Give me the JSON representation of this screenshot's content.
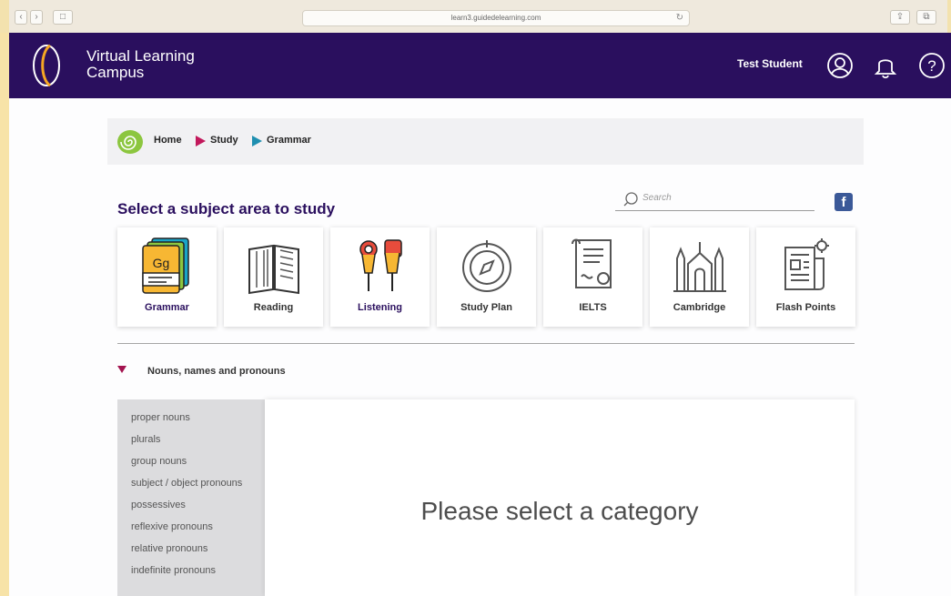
{
  "browser": {
    "url": "learn3.guidedelearning.com",
    "nav_back": "‹",
    "nav_forward": "›",
    "sidebar_toggle": "□"
  },
  "header": {
    "brand_line1": "Virtual Learning",
    "brand_line2": "Campus",
    "user_name": "Test Student",
    "icons": [
      "user-icon",
      "bell-icon",
      "help-icon"
    ]
  },
  "breadcrumb": {
    "items": [
      "Home",
      "Study",
      "Grammar"
    ]
  },
  "main": {
    "title": "Select a subject area to study",
    "search_placeholder": "Search",
    "facebook_label": "f",
    "tiles": [
      {
        "label": "Grammar",
        "icon": "grammar-book-icon",
        "active": true
      },
      {
        "label": "Reading",
        "icon": "open-book-icon"
      },
      {
        "label": "Listening",
        "icon": "earphones-icon",
        "active": true
      },
      {
        "label": "Study Plan",
        "icon": "compass-icon"
      },
      {
        "label": "IELTS",
        "icon": "certificate-icon"
      },
      {
        "label": "Cambridge",
        "icon": "cathedral-icon"
      },
      {
        "label": "Flash Points",
        "icon": "newspaper-gear-icon"
      }
    ],
    "section_title": "Nouns, names and pronouns",
    "categories": [
      "proper nouns",
      "plurals",
      "group nouns",
      "subject / object pronouns",
      "possessives",
      "reflexive pronouns",
      "relative pronouns",
      "indefinite pronouns"
    ],
    "placeholder_message": "Please select a category"
  },
  "colors": {
    "brand_purple": "#2a0f5e",
    "accent_magenta": "#c2185b",
    "accent_blue": "#1f8fb0"
  }
}
